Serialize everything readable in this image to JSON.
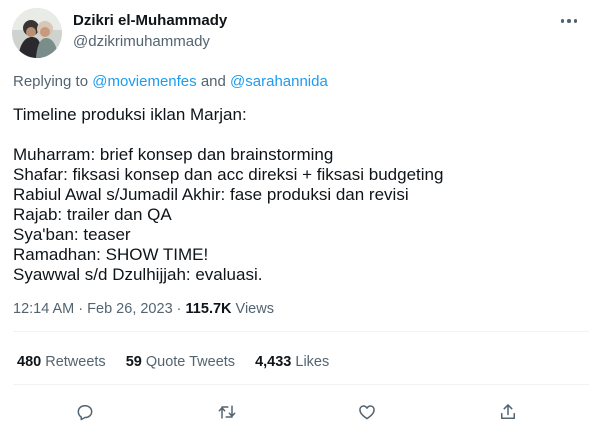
{
  "tweet": {
    "author_name": "Dzikri el-Muhammady",
    "author_handle": "@dzikrimuhammady",
    "reply_prefix": "Replying to",
    "reply_to_1": "@moviemenfes",
    "reply_and": "and",
    "reply_to_2": "@sarahannida",
    "text_lines": [
      "Timeline produksi iklan Marjan:",
      "",
      "Muharram: brief konsep dan brainstorming",
      "Shafar: fiksasi konsep dan acc direksi + fiksasi budgeting",
      "Rabiul Awal s/Jumadil Akhir: fase produksi dan revisi",
      "Rajab: trailer dan QA",
      "Sya'ban: teaser",
      "Ramadhan: SHOW TIME!",
      "Syawwal s/d Dzulhijjah: evaluasi."
    ],
    "time": "12:14 AM",
    "dot": "·",
    "date": "Feb 26, 2023",
    "dot2": "·",
    "views_count": "115.7K",
    "views_label": "Views"
  },
  "stats": {
    "retweets_count": "480",
    "retweets_label": "Retweets",
    "quotes_count": "59",
    "quotes_label": "Quote Tweets",
    "likes_count": "4,433",
    "likes_label": "Likes"
  },
  "icons": {
    "more": "more-dots-icon",
    "reply": "reply-bubble-icon",
    "retweet": "retweet-icon",
    "like": "heart-icon",
    "share": "share-icon"
  },
  "colors": {
    "link": "#1d9bf0",
    "secondary_text": "#536471",
    "primary_text": "#0f1419"
  }
}
